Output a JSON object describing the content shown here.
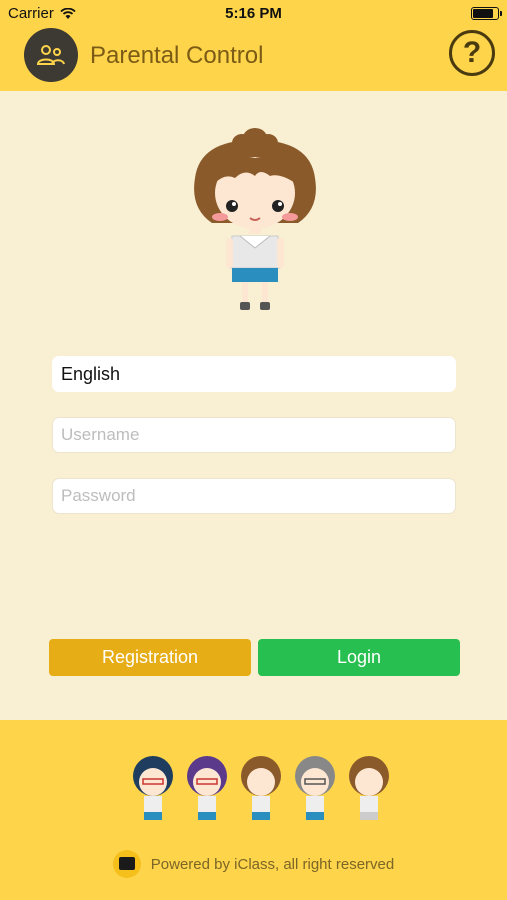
{
  "status_bar": {
    "carrier": "Carrier",
    "time": "5:16 PM",
    "battery_level": 0.75
  },
  "nav": {
    "title": "Parental Control",
    "help_label": "?"
  },
  "form": {
    "language": "English",
    "username_placeholder": "Username",
    "password_placeholder": "Password"
  },
  "actions": {
    "registration_label": "Registration",
    "login_label": "Login"
  },
  "footer": {
    "powered_by": "Powered by iClass, all right reserved"
  },
  "colors": {
    "header": "#fdd44a",
    "background": "#f9efd3",
    "registration": "#e7ad16",
    "login": "#27bf4f"
  },
  "icons": [
    "wifi-icon",
    "battery-icon",
    "parents-icon",
    "help-icon",
    "iclass-logo-icon"
  ]
}
